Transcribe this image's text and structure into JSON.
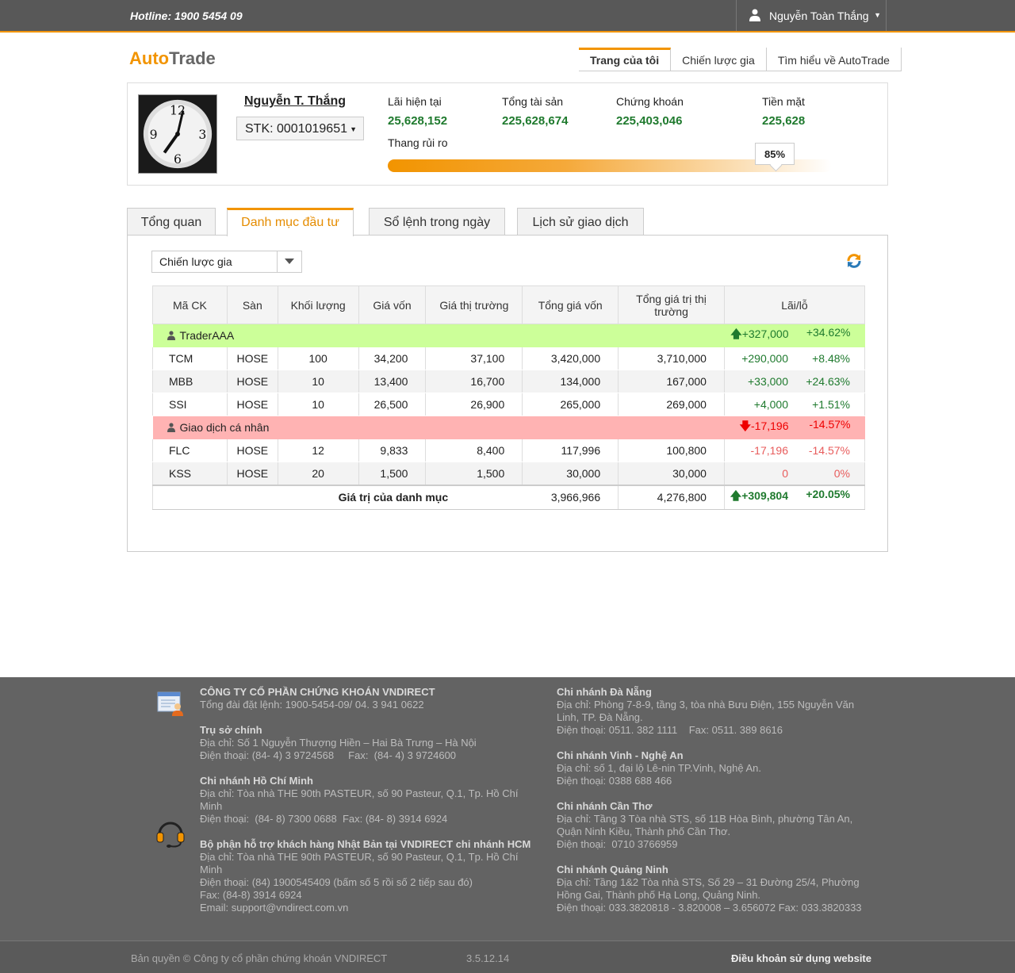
{
  "topbar": {
    "hotline": "Hotline: 1900 5454 09",
    "user_name": "Nguyễn Toàn Thắng"
  },
  "header": {
    "logo_part1": "Auto",
    "logo_part2": "Trade",
    "nav": [
      "Trang của tôi",
      "Chiến lược gia",
      "Tìm hiểu về AutoTrade"
    ]
  },
  "account": {
    "name": "Nguyễn T. Thắng",
    "account_select": "STK: 0001019651",
    "stats": [
      {
        "label": "Lãi hiện tại",
        "value": "25,628,152"
      },
      {
        "label": "Tổng tài sản",
        "value": "225,628,674"
      },
      {
        "label": "Chứng khoán",
        "value": "225,403,046"
      },
      {
        "label": "Tiền mặt",
        "value": "225,628"
      }
    ],
    "risk_label": "Thang rủi ro",
    "risk_pct_text": "85%",
    "risk_level": 0.85
  },
  "tabs": [
    "Tổng quan",
    "Danh mục đầu tư",
    "Sổ lệnh trong ngày",
    "Lịch sử giao dịch"
  ],
  "portfolio": {
    "strategy_select": "Chiến lược gia",
    "columns": [
      "Mã CK",
      "Sàn",
      "Khối lượng",
      "Giá vốn",
      "Giá thị trường",
      "Tổng giá vốn",
      "Tổng giá trị thị trường",
      "Lãi/lỗ"
    ],
    "group1": {
      "name": "TraderAAA",
      "pl": "+327,000",
      "pct": "+34.62%"
    },
    "group1_rows": [
      {
        "code": "TCM",
        "exchange": "HOSE",
        "qty": "100",
        "cost": "34,200",
        "market": "37,100",
        "total_cost": "3,420,000",
        "total_market": "3,710,000",
        "pl": "+290,000",
        "pct": "+8.48%"
      },
      {
        "code": "MBB",
        "exchange": "HOSE",
        "qty": "10",
        "cost": "13,400",
        "market": "16,700",
        "total_cost": "134,000",
        "total_market": "167,000",
        "pl": "+33,000",
        "pct": "+24.63%"
      },
      {
        "code": "SSI",
        "exchange": "HOSE",
        "qty": "10",
        "cost": "26,500",
        "market": "26,900",
        "total_cost": "265,000",
        "total_market": "269,000",
        "pl": "+4,000",
        "pct": "+1.51%"
      }
    ],
    "group2": {
      "name": "Giao dịch cá nhân",
      "pl": "-17,196",
      "pct": "-14.57%"
    },
    "group2_rows": [
      {
        "code": "FLC",
        "exchange": "HOSE",
        "qty": "12",
        "cost": "9,833",
        "market": "8,400",
        "total_cost": "117,996",
        "total_market": "100,800",
        "pl": "-17,196",
        "pct": "-14.57%"
      },
      {
        "code": "KSS",
        "exchange": "HOSE",
        "qty": "20",
        "cost": "1,500",
        "market": "1,500",
        "total_cost": "30,000",
        "total_market": "30,000",
        "pl": "0",
        "pct": "0%"
      }
    ],
    "total": {
      "label": "Giá trị của danh mục",
      "total_cost": "3,966,966",
      "total_market": "4,276,800",
      "pl": "+309,804",
      "pct": "+20.05%"
    }
  },
  "footer": {
    "company": "CÔNG TY CỔ PHẦN CHỨNG KHOÁN VNDIRECT",
    "company_phone": "Tổng đài đặt lệnh: 1900-5454-09/ 04. 3 941 0622",
    "hq_title": "Trụ sở chính",
    "hq_addr": "Địa chỉ: Số 1 Nguyễn Thượng Hiền – Hai Bà Trưng – Hà Nội",
    "hq_phone": "Điện thoại: (84- 4) 3 9724568     Fax:  (84- 4) 3 9724600",
    "hcm_title": "Chi nhánh Hồ Chí Minh",
    "hcm_addr": "Địa chỉ: Tòa nhà THE 90th PASTEUR, số 90 Pasteur, Q.1, Tp. Hồ Chí Minh",
    "hcm_phone": "Điện thoại:  (84- 8) 7300 0688  Fax: (84- 8) 3914 6924",
    "jp_title": "Bộ phận hỗ trợ khách hàng Nhật Bản tại VNDIRECT chi nhánh HCM",
    "jp_addr": "Địa chỉ: Tòa nhà THE 90th PASTEUR, số 90 Pasteur, Q.1, Tp. Hồ Chí Minh",
    "jp_phone": "Điện thoại: (84) 1900545409 (bấm số 5 rồi số 2 tiếp sau đó)",
    "jp_fax": "Fax: (84-8) 3914 6924",
    "jp_email": "Email: support@vndirect.com.vn",
    "dn_title": "Chi nhánh Đà Nẵng",
    "dn_addr": "Địa chỉ: Phòng 7-8-9, tầng 3, tòa nhà Bưu Điện, 155 Nguyễn Văn Linh, TP. Đà Nẵng.",
    "dn_phone": "Điện thoại: 0511. 382 1111    Fax: 0511. 389 8616",
    "vinh_title": "Chi nhánh Vinh - Nghệ An",
    "vinh_addr": "Địa chỉ: số 1, đại lộ Lê-nin TP.Vinh, Nghệ An.",
    "vinh_phone": "Điện thoại: 0388 688 466",
    "ct_title": "Chi nhánh Cần Thơ",
    "ct_addr": " Địa chỉ: Tầng 3 Tòa nhà STS, số 11B Hòa Bình, phường Tân An, Quận Ninh Kiều, Thành phố Cần Thơ.",
    "ct_phone": "Điện thoại:  0710 3766959",
    "qn_title": "Chi nhánh Quảng Ninh",
    "qn_addr": " Địa chỉ: Tầng 1&2 Tòa nhà STS, Số 29 – 31 Đường 25/4, Phường Hồng Gai, Thành phố Hạ Long, Quảng Ninh.",
    "qn_phone": "Điện thoại:  033.3820818 - 3.820008 – 3.656072      Fax: 033.3820333",
    "copyright": "Bản quyền © Công ty cổ phần chứng khoán VNDIRECT",
    "version": "3.5.12.14",
    "terms": "Điều khoản sử dụng website"
  },
  "colors": {
    "accent": "#f29400",
    "positive": "#1f7a2e",
    "negative": "#e85c5c",
    "group_green": "#ccff99",
    "group_red": "#ffb3b3"
  }
}
